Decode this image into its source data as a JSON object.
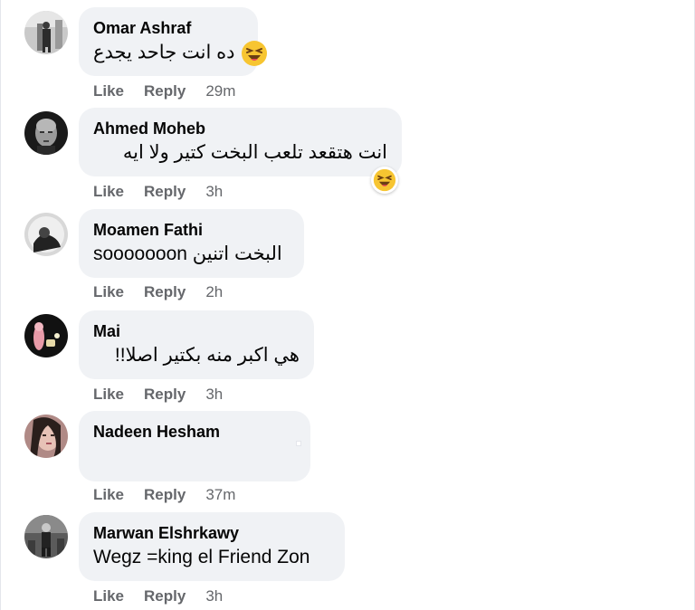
{
  "actions": {
    "like_label": "Like",
    "reply_label": "Reply"
  },
  "comments": [
    {
      "author": "Omar Ashraf",
      "text": "ده انت جاحد يجدع",
      "time": "29m",
      "emoji": "laughing-icon"
    },
    {
      "author": "Ahmed Moheb",
      "text": "انت هتقعد تلعب البخت كتير ولا ايه",
      "time": "3h",
      "reaction": "laughing-icon"
    },
    {
      "author": "Moamen Fathi",
      "text": "البخت اتنين sooooooon",
      "time": "2h"
    },
    {
      "author": "Mai",
      "text": "هي اكبر منه بكتير اصلا!!",
      "time": "3h"
    },
    {
      "author": "Nadeen Hesham",
      "text": "",
      "time": "37m"
    },
    {
      "author": "Marwan Elshrkawy",
      "text": "Wegz =king el Friend Zon",
      "time": "3h"
    }
  ],
  "colors": {
    "bubble": "#f0f2f5",
    "action_text": "#65676b",
    "emoji_face": "#f7c531"
  }
}
